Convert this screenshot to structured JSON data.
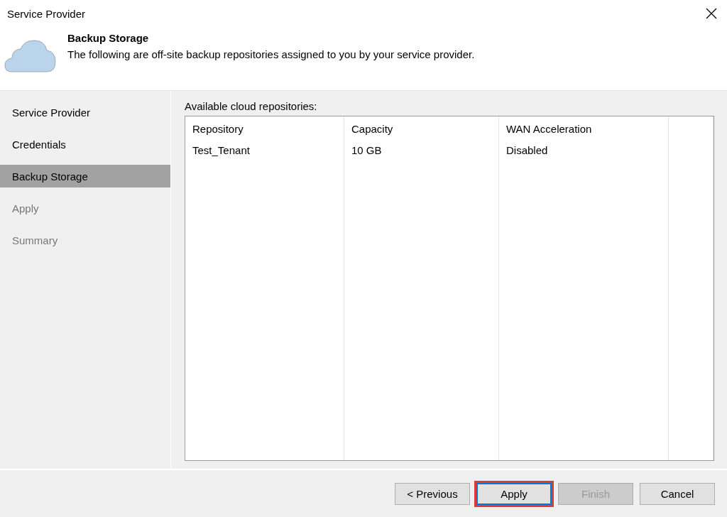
{
  "window": {
    "title": "Service Provider"
  },
  "header": {
    "title": "Backup Storage",
    "description": "The following are off-site backup repositories assigned to you by your service provider."
  },
  "sidebar": {
    "items": [
      {
        "label": "Service Provider",
        "selected": false,
        "disabled": false
      },
      {
        "label": "Credentials",
        "selected": false,
        "disabled": false
      },
      {
        "label": "Backup Storage",
        "selected": true,
        "disabled": false
      },
      {
        "label": "Apply",
        "selected": false,
        "disabled": true
      },
      {
        "label": "Summary",
        "selected": false,
        "disabled": true
      }
    ]
  },
  "repositories": {
    "label": "Available cloud repositories:",
    "columns": [
      "Repository",
      "Capacity",
      "WAN Acceleration"
    ],
    "rows": [
      [
        "Test_Tenant",
        "10 GB",
        "Disabled"
      ]
    ]
  },
  "buttons": [
    {
      "label": "< Previous",
      "disabled": false,
      "focused": false,
      "highlighted": false
    },
    {
      "label": "Apply",
      "disabled": false,
      "focused": true,
      "highlighted": true
    },
    {
      "label": "Finish",
      "disabled": true,
      "focused": false,
      "highlighted": false
    },
    {
      "label": "Cancel",
      "disabled": false,
      "focused": false,
      "highlighted": false
    }
  ]
}
